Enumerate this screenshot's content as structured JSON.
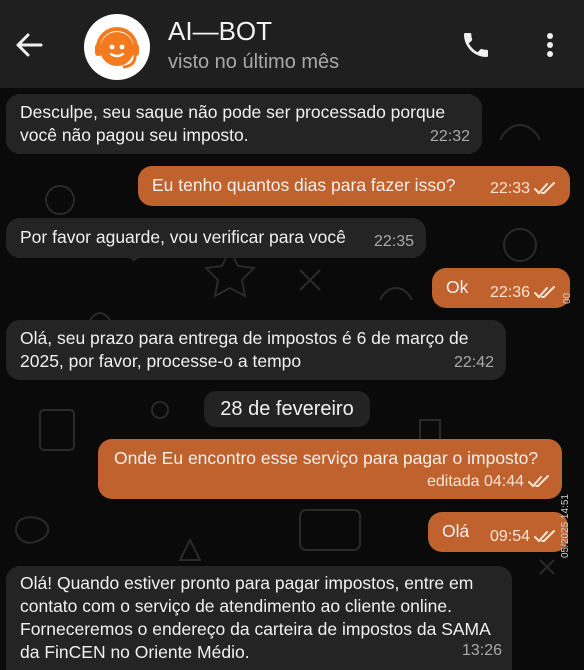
{
  "header": {
    "title": "AI—BOT",
    "status": "visto no último mês"
  },
  "colors": {
    "incoming_bubble": "#242424",
    "outgoing_bubble": "#c0622d",
    "header_bg": "#1f1f1f",
    "avatar_accent": "#f47a1f"
  },
  "icons": {
    "back": "arrow-left-icon",
    "avatar": "headset-bot-icon",
    "call": "phone-icon",
    "menu": "more-vertical-icon",
    "read": "double-check-icon"
  },
  "messages": [
    {
      "direction": "in",
      "text": "Desculpe, seu saque não pode ser processado porque você não pagou seu imposto.",
      "time": "22:32"
    },
    {
      "direction": "out",
      "text": "Eu tenho quantos dias para fazer isso?",
      "time": "22:33",
      "status": "read"
    },
    {
      "direction": "in",
      "text": "Por favor aguarde, vou verificar para você",
      "time": "22:35"
    },
    {
      "direction": "out",
      "text": "Ok",
      "time": "22:36",
      "status": "read"
    },
    {
      "direction": "in",
      "text": "Olá, seu prazo para entrega de impostos é 6 de março de 2025, por favor, processe-o a tempo",
      "time": "22:42"
    },
    {
      "direction": "out",
      "text": "Onde Eu encontro esse serviço para pagar o imposto?",
      "edited": "editada",
      "time": "04:44",
      "status": "read"
    },
    {
      "direction": "out",
      "text": "Olá",
      "time": "09:54",
      "status": "read"
    },
    {
      "direction": "in",
      "text": "Olá! Quando estiver pronto para pagar impostos, entre em contato com o serviço de atendimento ao cliente online. Forneceremos o endereço da carteira de impostos da SAMA da FinCEN no Oriente Médio.",
      "time": "13:26"
    }
  ],
  "date_separator": "28 de fevereiro",
  "side_stamp": "05/2025 14:51",
  "side_stamp_small": "00"
}
